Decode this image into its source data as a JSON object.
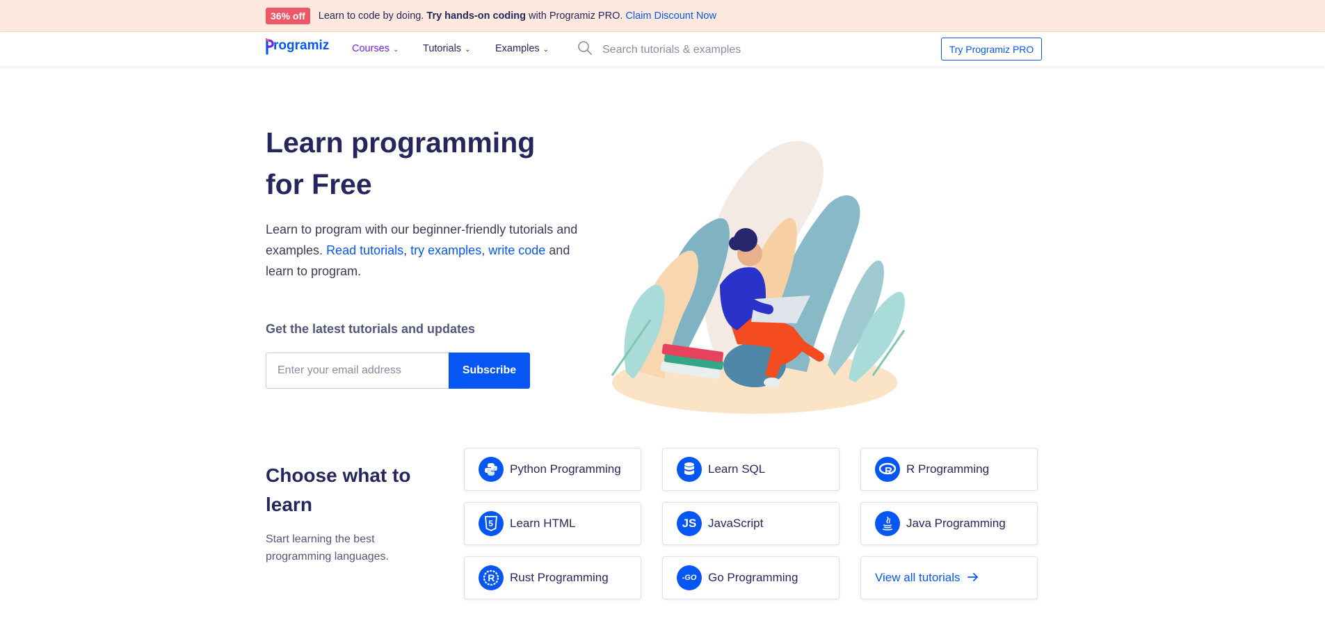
{
  "promo": {
    "badge": "36% off",
    "text_plain": "Learn to code by doing.",
    "text_strong": "Try hands-on coding",
    "text_after": "with Programiz PRO.",
    "link": "Claim Discount Now"
  },
  "nav": {
    "logo": "rogramiz",
    "items": [
      {
        "label": "Courses"
      },
      {
        "label": "Tutorials"
      },
      {
        "label": "Examples"
      }
    ],
    "search_placeholder": "Search tutorials & examples",
    "pro_button": "Try Programiz PRO"
  },
  "hero": {
    "title_line1": "Learn programming",
    "title_line2": "for Free",
    "text_before": "Learn to program with our beginner-friendly tutorials and examples.",
    "link1": "Read tutorials",
    "sep1": ",",
    "link2": "try examples",
    "sep2": ",",
    "link3": "write code",
    "text_after": "and learn to program.",
    "subscribe_heading": "Get the latest tutorials and updates",
    "email_placeholder": "Enter your email address",
    "subscribe_button": "Subscribe"
  },
  "choose": {
    "title": "Choose what to learn",
    "text": "Start learning the best programming languages.",
    "cards": [
      {
        "label": "Python Programming",
        "icon": "python-icon"
      },
      {
        "label": "Learn SQL",
        "icon": "database-icon"
      },
      {
        "label": "R Programming",
        "icon": "r-icon"
      },
      {
        "label": "Learn HTML",
        "icon": "html5-icon"
      },
      {
        "label": "JavaScript",
        "icon": "js-icon"
      },
      {
        "label": "Java Programming",
        "icon": "java-icon"
      },
      {
        "label": "Rust Programming",
        "icon": "rust-icon"
      },
      {
        "label": "Go Programming",
        "icon": "go-icon"
      }
    ],
    "view_all": "View all tutorials",
    "js_icon_text": "JS",
    "go_icon_text": "-GO",
    "html_icon_text": "5",
    "r_icon_text": "R"
  },
  "colors": {
    "brand": "#0556f3",
    "heading": "#25265e",
    "promo_bg": "#fde9dd",
    "badge": "#ee5765",
    "active_nav": "#6c1ff0"
  }
}
